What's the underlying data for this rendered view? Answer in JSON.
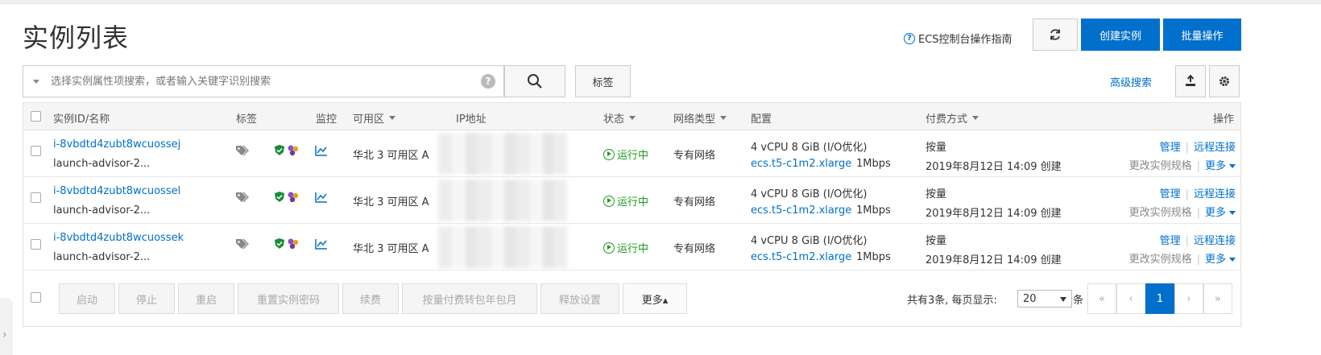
{
  "title": "实例列表",
  "header": {
    "guide_label": "ECS控制台操作指南",
    "create_label": "创建实例",
    "batch_label": "批量操作"
  },
  "search": {
    "placeholder": "选择实例属性项搜索，或者输入关键字识别搜索",
    "tag_label": "标签",
    "advanced_label": "高级搜索"
  },
  "columns": {
    "id": "实例ID/名称",
    "tags": "标签",
    "monitor": "监控",
    "zone": "可用区",
    "ip": "IP地址",
    "status": "状态",
    "network": "网络类型",
    "config": "配置",
    "billing": "付费方式",
    "ops": "操作"
  },
  "rows": [
    {
      "id": "i-8vbdtd4zubt8wcuossej",
      "name": "launch-advisor-2...",
      "zone": "华北 3 可用区 A",
      "status": "运行中",
      "network": "专有网络",
      "config": "4 vCPU 8 GiB (I/O优化)",
      "spec": "ecs.t5-c1m2.xlarge",
      "bandwidth": "1Mbps",
      "billing": "按量",
      "created": "2019年8月12日 14:09 创建",
      "manage": "管理",
      "remote": "远程连接",
      "change_spec": "更改实例规格",
      "more": "更多"
    },
    {
      "id": "i-8vbdtd4zubt8wcuossel",
      "name": "launch-advisor-2...",
      "zone": "华北 3 可用区 A",
      "status": "运行中",
      "network": "专有网络",
      "config": "4 vCPU 8 GiB (I/O优化)",
      "spec": "ecs.t5-c1m2.xlarge",
      "bandwidth": "1Mbps",
      "billing": "按量",
      "created": "2019年8月12日 14:09 创建",
      "manage": "管理",
      "remote": "远程连接",
      "change_spec": "更改实例规格",
      "more": "更多"
    },
    {
      "id": "i-8vbdtd4zubt8wcuossek",
      "name": "launch-advisor-2...",
      "zone": "华北 3 可用区 A",
      "status": "运行中",
      "network": "专有网络",
      "config": "4 vCPU 8 GiB (I/O优化)",
      "spec": "ecs.t5-c1m2.xlarge",
      "bandwidth": "1Mbps",
      "billing": "按量",
      "created": "2019年8月12日 14:09 创建",
      "manage": "管理",
      "remote": "远程连接",
      "change_spec": "更改实例规格",
      "more": "更多"
    }
  ],
  "footer": {
    "start": "启动",
    "stop": "停止",
    "restart": "重启",
    "reset_password": "重置实例密码",
    "renew": "续费",
    "convert": "按量付费转包年包月",
    "release": "释放设置",
    "more": "更多▴",
    "total_text": "共有3条, 每页显示:",
    "page_size": "20",
    "unit": "条",
    "current_page": "1"
  },
  "colors": {
    "primary": "#0070cc",
    "running": "#1d9a1d"
  }
}
